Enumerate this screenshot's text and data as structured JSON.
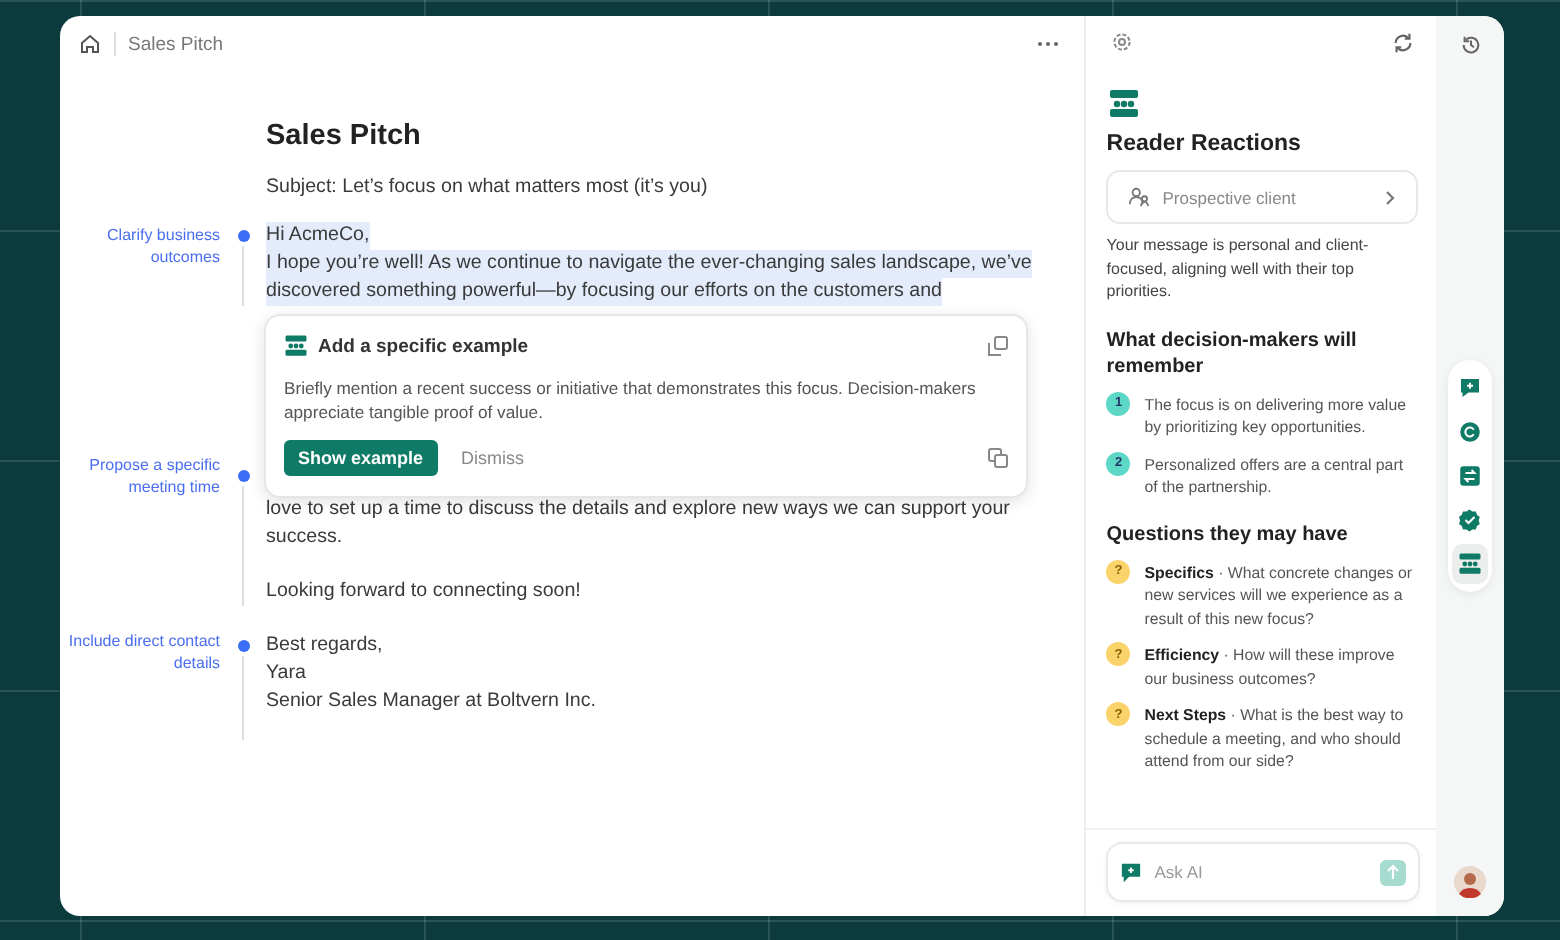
{
  "header": {
    "breadcrumb": "Sales Pitch"
  },
  "document": {
    "title": "Sales Pitch",
    "subject": "Subject: Let’s focus on what matters most (it’s you)",
    "sections": [
      {
        "note": "Clarify business outcomes",
        "highlighted": true,
        "paragraphs": [
          [
            "Hi AcmeCo,"
          ],
          [
            "I hope you’re well! As we continue to navigate the ever-changing sales landscape, we’ve",
            "discovered something powerful—by focusing our efforts on the customers and"
          ]
        ]
      },
      {
        "note": "Propose a specific meeting time",
        "highlighted": false,
        "paragraphs": [
          [
            "love to set up a time to discuss the details and explore new ways we can support your",
            "success."
          ],
          [
            "Looking forward to connecting soon!"
          ]
        ]
      },
      {
        "note": "Include direct contact details",
        "highlighted": false,
        "paragraphs": [
          [
            "Best regards,",
            "Yara",
            "Senior Sales Manager at Boltvern Inc."
          ]
        ]
      }
    ]
  },
  "suggestion": {
    "title": "Add a specific example",
    "body": "Briefly mention a recent success or initiative that demonstrates this focus. Decision-makers appreciate tangible proof of value.",
    "primary": "Show example",
    "secondary": "Dismiss"
  },
  "panel": {
    "title": "Reader Reactions",
    "audience": "Prospective client",
    "summary": "Your message is personal and client-focused, aligning well with their top priorities.",
    "remember_title": "What decision-makers will remember",
    "remember": [
      {
        "number": "1",
        "text": "The focus is on delivering more value by prioritizing key opportunities."
      },
      {
        "number": "2",
        "text": "Personalized offers are a central part of the partnership."
      }
    ],
    "questions_title": "Questions they may have",
    "questions": [
      {
        "mark": "?",
        "text": "**Specifics** · What concrete changes or new services will we experience as a result of this new focus?"
      },
      {
        "mark": "?",
        "text": "**Efficiency** · How will these improve our business outcomes?"
      },
      {
        "mark": "?",
        "text": "**Next Steps** · What is the best way to schedule a meeting, and who should attend from our side?"
      }
    ],
    "ask": {
      "placeholder": "Ask AI"
    }
  },
  "rail": [
    {
      "selected": false
    },
    {
      "selected": false
    },
    {
      "selected": false
    },
    {
      "selected": false
    },
    {
      "selected": true
    }
  ]
}
